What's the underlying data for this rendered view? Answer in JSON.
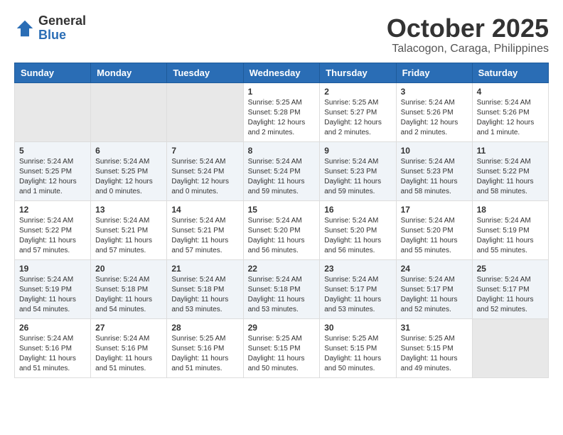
{
  "logo": {
    "general": "General",
    "blue": "Blue"
  },
  "title": "October 2025",
  "location": "Talacogon, Caraga, Philippines",
  "days_of_week": [
    "Sunday",
    "Monday",
    "Tuesday",
    "Wednesday",
    "Thursday",
    "Friday",
    "Saturday"
  ],
  "weeks": [
    [
      {
        "day": "",
        "empty": true
      },
      {
        "day": "",
        "empty": true
      },
      {
        "day": "",
        "empty": true
      },
      {
        "day": "1",
        "sunrise": "Sunrise: 5:25 AM",
        "sunset": "Sunset: 5:28 PM",
        "daylight": "Daylight: 12 hours and 2 minutes."
      },
      {
        "day": "2",
        "sunrise": "Sunrise: 5:25 AM",
        "sunset": "Sunset: 5:27 PM",
        "daylight": "Daylight: 12 hours and 2 minutes."
      },
      {
        "day": "3",
        "sunrise": "Sunrise: 5:24 AM",
        "sunset": "Sunset: 5:26 PM",
        "daylight": "Daylight: 12 hours and 2 minutes."
      },
      {
        "day": "4",
        "sunrise": "Sunrise: 5:24 AM",
        "sunset": "Sunset: 5:26 PM",
        "daylight": "Daylight: 12 hours and 1 minute."
      }
    ],
    [
      {
        "day": "5",
        "sunrise": "Sunrise: 5:24 AM",
        "sunset": "Sunset: 5:25 PM",
        "daylight": "Daylight: 12 hours and 1 minute."
      },
      {
        "day": "6",
        "sunrise": "Sunrise: 5:24 AM",
        "sunset": "Sunset: 5:25 PM",
        "daylight": "Daylight: 12 hours and 0 minutes."
      },
      {
        "day": "7",
        "sunrise": "Sunrise: 5:24 AM",
        "sunset": "Sunset: 5:24 PM",
        "daylight": "Daylight: 12 hours and 0 minutes."
      },
      {
        "day": "8",
        "sunrise": "Sunrise: 5:24 AM",
        "sunset": "Sunset: 5:24 PM",
        "daylight": "Daylight: 11 hours and 59 minutes."
      },
      {
        "day": "9",
        "sunrise": "Sunrise: 5:24 AM",
        "sunset": "Sunset: 5:23 PM",
        "daylight": "Daylight: 11 hours and 59 minutes."
      },
      {
        "day": "10",
        "sunrise": "Sunrise: 5:24 AM",
        "sunset": "Sunset: 5:23 PM",
        "daylight": "Daylight: 11 hours and 58 minutes."
      },
      {
        "day": "11",
        "sunrise": "Sunrise: 5:24 AM",
        "sunset": "Sunset: 5:22 PM",
        "daylight": "Daylight: 11 hours and 58 minutes."
      }
    ],
    [
      {
        "day": "12",
        "sunrise": "Sunrise: 5:24 AM",
        "sunset": "Sunset: 5:22 PM",
        "daylight": "Daylight: 11 hours and 57 minutes."
      },
      {
        "day": "13",
        "sunrise": "Sunrise: 5:24 AM",
        "sunset": "Sunset: 5:21 PM",
        "daylight": "Daylight: 11 hours and 57 minutes."
      },
      {
        "day": "14",
        "sunrise": "Sunrise: 5:24 AM",
        "sunset": "Sunset: 5:21 PM",
        "daylight": "Daylight: 11 hours and 57 minutes."
      },
      {
        "day": "15",
        "sunrise": "Sunrise: 5:24 AM",
        "sunset": "Sunset: 5:20 PM",
        "daylight": "Daylight: 11 hours and 56 minutes."
      },
      {
        "day": "16",
        "sunrise": "Sunrise: 5:24 AM",
        "sunset": "Sunset: 5:20 PM",
        "daylight": "Daylight: 11 hours and 56 minutes."
      },
      {
        "day": "17",
        "sunrise": "Sunrise: 5:24 AM",
        "sunset": "Sunset: 5:20 PM",
        "daylight": "Daylight: 11 hours and 55 minutes."
      },
      {
        "day": "18",
        "sunrise": "Sunrise: 5:24 AM",
        "sunset": "Sunset: 5:19 PM",
        "daylight": "Daylight: 11 hours and 55 minutes."
      }
    ],
    [
      {
        "day": "19",
        "sunrise": "Sunrise: 5:24 AM",
        "sunset": "Sunset: 5:19 PM",
        "daylight": "Daylight: 11 hours and 54 minutes."
      },
      {
        "day": "20",
        "sunrise": "Sunrise: 5:24 AM",
        "sunset": "Sunset: 5:18 PM",
        "daylight": "Daylight: 11 hours and 54 minutes."
      },
      {
        "day": "21",
        "sunrise": "Sunrise: 5:24 AM",
        "sunset": "Sunset: 5:18 PM",
        "daylight": "Daylight: 11 hours and 53 minutes."
      },
      {
        "day": "22",
        "sunrise": "Sunrise: 5:24 AM",
        "sunset": "Sunset: 5:18 PM",
        "daylight": "Daylight: 11 hours and 53 minutes."
      },
      {
        "day": "23",
        "sunrise": "Sunrise: 5:24 AM",
        "sunset": "Sunset: 5:17 PM",
        "daylight": "Daylight: 11 hours and 53 minutes."
      },
      {
        "day": "24",
        "sunrise": "Sunrise: 5:24 AM",
        "sunset": "Sunset: 5:17 PM",
        "daylight": "Daylight: 11 hours and 52 minutes."
      },
      {
        "day": "25",
        "sunrise": "Sunrise: 5:24 AM",
        "sunset": "Sunset: 5:17 PM",
        "daylight": "Daylight: 11 hours and 52 minutes."
      }
    ],
    [
      {
        "day": "26",
        "sunrise": "Sunrise: 5:24 AM",
        "sunset": "Sunset: 5:16 PM",
        "daylight": "Daylight: 11 hours and 51 minutes."
      },
      {
        "day": "27",
        "sunrise": "Sunrise: 5:24 AM",
        "sunset": "Sunset: 5:16 PM",
        "daylight": "Daylight: 11 hours and 51 minutes."
      },
      {
        "day": "28",
        "sunrise": "Sunrise: 5:25 AM",
        "sunset": "Sunset: 5:16 PM",
        "daylight": "Daylight: 11 hours and 51 minutes."
      },
      {
        "day": "29",
        "sunrise": "Sunrise: 5:25 AM",
        "sunset": "Sunset: 5:15 PM",
        "daylight": "Daylight: 11 hours and 50 minutes."
      },
      {
        "day": "30",
        "sunrise": "Sunrise: 5:25 AM",
        "sunset": "Sunset: 5:15 PM",
        "daylight": "Daylight: 11 hours and 50 minutes."
      },
      {
        "day": "31",
        "sunrise": "Sunrise: 5:25 AM",
        "sunset": "Sunset: 5:15 PM",
        "daylight": "Daylight: 11 hours and 49 minutes."
      },
      {
        "day": "",
        "empty": true
      }
    ]
  ]
}
